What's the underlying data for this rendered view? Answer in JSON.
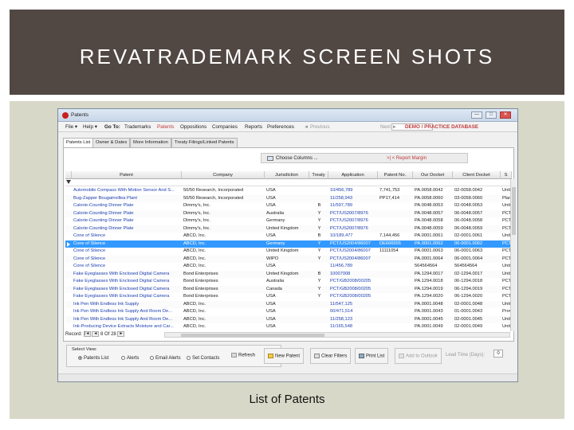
{
  "slide": {
    "title": "REVATRADEMARK SCREEN SHOTS",
    "caption": "List of Patents"
  },
  "window": {
    "title": "Patents",
    "buttons": {
      "minimize": "—",
      "maximize": "□",
      "close": "✕"
    }
  },
  "menu": {
    "file": "File ▾",
    "help": "Help ▾",
    "goto": "Go To:",
    "trademarks": "Trademarks",
    "patents": "Patents",
    "oppositions": "Oppositions",
    "companies": "Companies",
    "reports": "Reports",
    "preferences": "Preferences",
    "previous": "◄ Previous",
    "next": "Next ►",
    "database": "DEMO / PRACTICE DATABASE"
  },
  "tabs": [
    "Patents List",
    "Owner & Dates",
    "More Information",
    "Treaty Filings/Linked Patents"
  ],
  "toolbar": {
    "choose_columns": "Choose Columns ...",
    "report_margin": ">| < Report Margin"
  },
  "columns": [
    "Patent",
    "Company",
    "Jurisdiction",
    "Treaty",
    "Application",
    "Patent No.",
    "Our Docket",
    "Client Docket",
    "S"
  ],
  "rows": [
    [
      "Automobile Compass With Motion Sensor And S...",
      "50/50 Research, Incorporated",
      "USA",
      "",
      "10/456,789",
      "7,741,753",
      "PA.0058.0042",
      "02-0058.0042",
      "Unit"
    ],
    [
      "Bug-Zapper Bougainvillea Plant",
      "50/50 Research, Incorporated",
      "USA",
      "",
      "11/258,943",
      "PP17,414",
      "PA.0058.0060",
      "03-0058.0060",
      "Plan"
    ],
    [
      "Calorie-Counting Dinner Plate",
      "Dimmy's, Inc.",
      "USA",
      "B",
      "11/597,789",
      "",
      "PA.0048.0053",
      "02-0048.0053",
      "Unit"
    ],
    [
      "Calorie-Counting Dinner Plate",
      "Dimmy's, Inc.",
      "Australia",
      "Y",
      "PCT/US2007/8976",
      "",
      "PA.0048.0057",
      "06-0048.0057",
      "PCT"
    ],
    [
      "Calorie-Counting Dinner Plate",
      "Dimmy's, Inc.",
      "Germany",
      "Y",
      "PCT/US2007/8976",
      "",
      "PA.0048.0058",
      "06-0048.0058",
      "PCT"
    ],
    [
      "Calorie-Counting Dinner Plate",
      "Dimmy's, Inc.",
      "United Kingdom",
      "Y",
      "PCT/US2007/8976",
      "",
      "PA.0048.0059",
      "06-0048.0059",
      "PCT"
    ],
    [
      "Cone of Silence",
      "ABCD, Inc.",
      "USA",
      "B",
      "10/189,477",
      "7,144,456",
      "PA.0001.0061",
      "02-0001.0061",
      "Unit"
    ],
    [
      "Cone of Silence",
      "ABCD, Inc.",
      "Germany",
      "Y",
      "PCT/US2004/86007",
      "DE666555",
      "PA.0001.0062",
      "06-0001.0062",
      "PCT"
    ],
    [
      "Cone of Silence",
      "ABCD, Inc.",
      "United Kingdom",
      "Y",
      "PCT/US2004/86007",
      "11111054",
      "PA.0001.0063",
      "06-0001.0063",
      "PCT"
    ],
    [
      "Cone of Silence",
      "ABCD, Inc.",
      "WIPO",
      "Y",
      "PCT/US2004/86007",
      "",
      "PA.0001.0064",
      "06-0001.0064",
      "PCT"
    ],
    [
      "Cone of Silence",
      "ABCD, Inc.",
      "USA",
      "",
      "11/456,789",
      "",
      "564564564",
      "564564564",
      "Unit"
    ],
    [
      "Fake Eyeglasses With Enclosed Digital Camera",
      "Bond Enterprises",
      "United Kingdom",
      "B",
      "10007008",
      "",
      "PA.1294.0017",
      "02-1294.0017",
      "Unit"
    ],
    [
      "Fake Eyeglasses With Enclosed Digital Camera",
      "Bond Enterprises",
      "Australia",
      "Y",
      "PCT/GB2008/00205",
      "",
      "PA.1294.0018",
      "06-1294.0018",
      "PCT"
    ],
    [
      "Fake Eyeglasses With Enclosed Digital Camera",
      "Bond Enterprises",
      "Canada",
      "Y",
      "PCT/GB2008/00205",
      "",
      "PA.1294.0019",
      "06-1294.0019",
      "PCT"
    ],
    [
      "Fake Eyeglasses With Enclosed Digital Camera",
      "Bond Enterprises",
      "USA",
      "Y",
      "PCT/GB2008/00205",
      "",
      "PA.1294.0020",
      "06-1294.0020",
      "PCT"
    ],
    [
      "Ink Pen With Endless Ink Supply",
      "ABCD, Inc.",
      "USA",
      "",
      "11/547,125",
      "",
      "PA.0001.0048",
      "02-0001.0048",
      "Unit"
    ],
    [
      "Ink Pen With Endless Ink Supply And Room De...",
      "ABCD, Inc.",
      "USA",
      "",
      "60/471,514",
      "",
      "PA.0001.0043",
      "01-0001.0043",
      "Prov"
    ],
    [
      "Ink Pen With Endless Ink Supply And Room De...",
      "ABCD, Inc.",
      "USA",
      "",
      "11/258,123",
      "",
      "PA.0001.0045",
      "02-0001.0045",
      "Unit"
    ],
    [
      "Ink-Producing Device Extracts Moisture and Car...",
      "ABCD, Inc.",
      "USA",
      "",
      "11/165,548",
      "",
      "PA.0001.0049",
      "02-0001.0049",
      "Unit"
    ]
  ],
  "selected_row": 7,
  "record": {
    "label": "Record:",
    "current": "8",
    "of": "Of",
    "total": "28"
  },
  "select_view": {
    "label": "Select View:",
    "options": [
      "Patents List",
      "Alerts",
      "Email Alerts",
      "Set Contacts"
    ],
    "selected": "Patents List"
  },
  "buttons": {
    "refresh": "Refresh",
    "new_patent": "New Patent",
    "clear_filters": "Clear Filters",
    "print_list": "Print List",
    "add_to_outlook": "Add to Outlook",
    "lead_time": "Lead Time (Days):",
    "lead_time_value": "0"
  },
  "colors": {
    "header_bg": "#514743",
    "selection": "#3399ff",
    "link": "#1c3fb0",
    "accent_red": "#c0393b"
  }
}
